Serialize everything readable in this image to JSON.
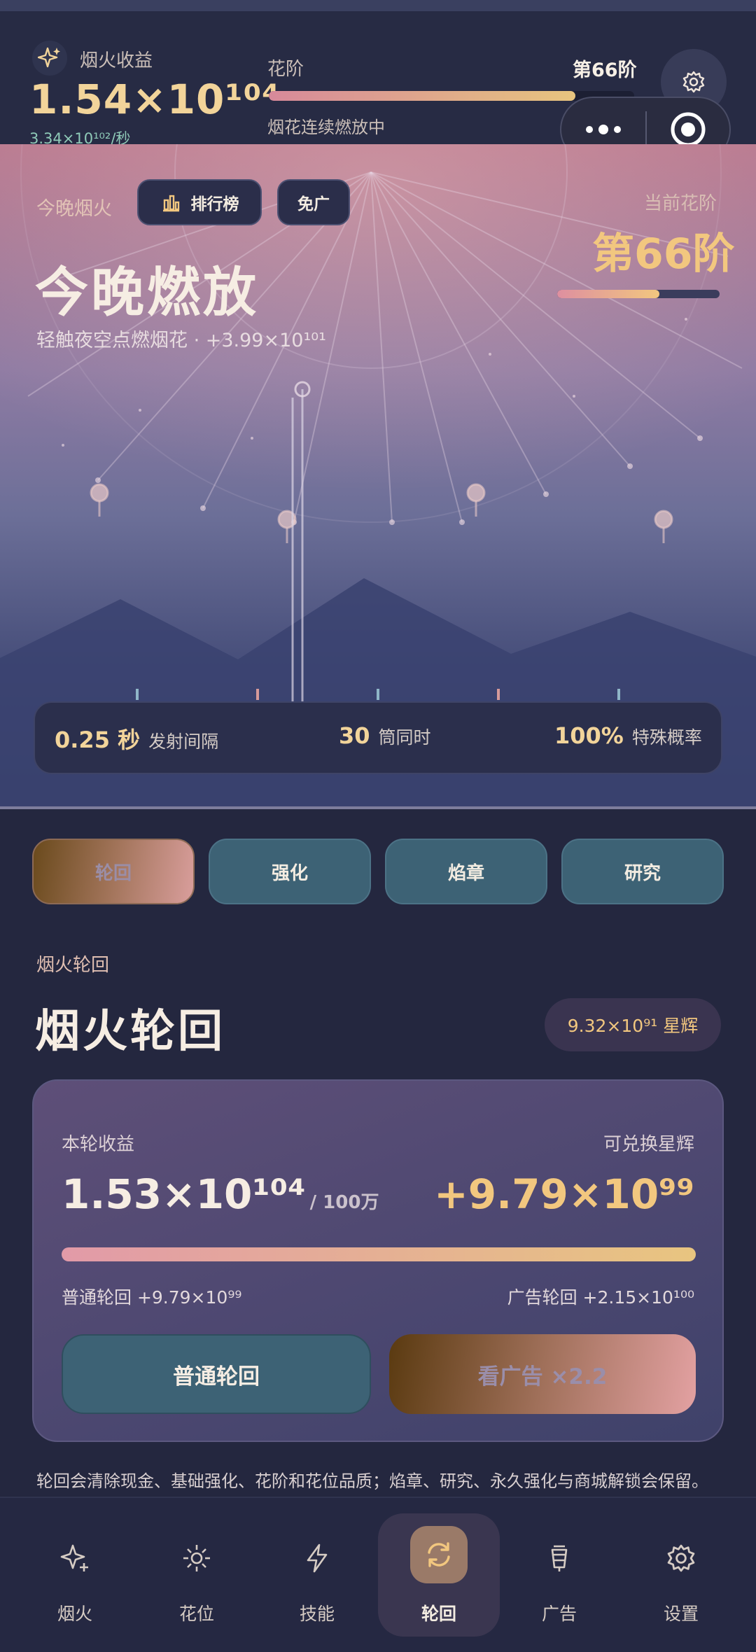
{
  "header": {
    "income_label": "烟火收益",
    "income_value": "1.54×10¹⁰⁴",
    "income_rate": "3.34×10¹⁰²/秒",
    "stage_label": "花阶",
    "stage_value": "第66阶",
    "stage_progress": 0.84,
    "stage_status": "烟花连续燃放中"
  },
  "sky": {
    "tonight_label": "今晚烟火",
    "rank_label": "排行榜",
    "noad_label": "免广",
    "current_stage_label": "当前花阶",
    "current_stage_value": "第66阶",
    "current_stage_progress": 0.63,
    "title": "今晚燃放",
    "subtitle": "轻触夜空点燃烟花 · +3.99×10¹⁰¹",
    "stats": [
      {
        "value": "0.25 秒",
        "label": "发射间隔"
      },
      {
        "value": "30",
        "label": "筒同时"
      },
      {
        "value": "100%",
        "label": "特殊概率"
      }
    ]
  },
  "tabs": [
    {
      "label": "轮回",
      "active": true
    },
    {
      "label": "强化",
      "active": false
    },
    {
      "label": "焰章",
      "active": false
    },
    {
      "label": "研究",
      "active": false
    }
  ],
  "section": {
    "tag": "烟火轮回",
    "title": "烟火轮回",
    "stardust": "9.32×10⁹¹ 星辉"
  },
  "card": {
    "income_label": "本轮收益",
    "exchange_label": "可兑换星辉",
    "income_value": "1.53×10¹⁰⁴",
    "income_target": "/ 100万",
    "exchange_value": "+9.79×10⁹⁹",
    "normal_reward": "普通轮回 +9.79×10⁹⁹",
    "ad_reward": "广告轮回 +2.15×10¹⁰⁰",
    "normal_button": "普通轮回",
    "ad_button": "看广告 ×2.2"
  },
  "footnote": "轮回会清除现金、基础强化、花阶和花位品质；焰章、研究、永久强化与商城解锁会保留。",
  "nav": [
    {
      "label": "烟火",
      "icon": "sparkle-icon"
    },
    {
      "label": "花位",
      "icon": "sun-icon"
    },
    {
      "label": "技能",
      "icon": "lightning-icon"
    },
    {
      "label": "轮回",
      "icon": "cycle-icon",
      "active": true
    },
    {
      "label": "广告",
      "icon": "lantern-icon"
    },
    {
      "label": "设置",
      "icon": "gear-icon"
    }
  ],
  "colors": {
    "accent_gold": "#f2c77f",
    "teal_button": "#3d6275",
    "background": "#24273f"
  }
}
